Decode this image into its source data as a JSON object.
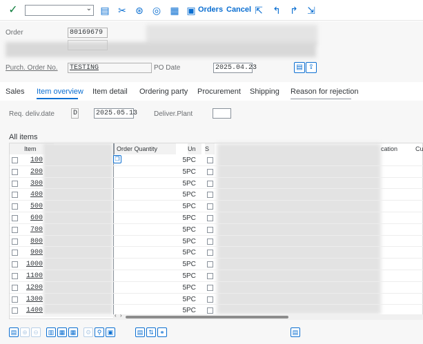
{
  "toolbar": {
    "command_value": "",
    "orders_label": "Orders",
    "cancel_label": "Cancel"
  },
  "header": {
    "order_label": "Order",
    "order_value": "80169679",
    "po_label": "Purch. Order No.",
    "po_value": "TESTING",
    "podate_label": "PO Date",
    "podate_value": "2025.04.23"
  },
  "tabs": [
    {
      "label": "Sales"
    },
    {
      "label": "Item overview"
    },
    {
      "label": "Item detail"
    },
    {
      "label": "Ordering party"
    },
    {
      "label": "Procurement"
    },
    {
      "label": "Shipping"
    },
    {
      "label": "Reason for rejection"
    }
  ],
  "subarea": {
    "reqdeliv_label": "Req. deliv.date",
    "reqdeliv_type": "D",
    "reqdeliv_value": "2025.05.13",
    "plant_label": "Deliver.Plant",
    "plant_value": ""
  },
  "table": {
    "title": "All items",
    "col_item": "Item",
    "col_qty": "Order Quantity",
    "col_un": "Un",
    "col_s": "S",
    "col_loc": "cation",
    "col_cu": "Cu",
    "rows": [
      {
        "item": "100",
        "qty": "5",
        "un": "PC"
      },
      {
        "item": "200",
        "qty": "5",
        "un": "PC"
      },
      {
        "item": "300",
        "qty": "5",
        "un": "PC"
      },
      {
        "item": "400",
        "qty": "5",
        "un": "PC"
      },
      {
        "item": "500",
        "qty": "5",
        "un": "PC"
      },
      {
        "item": "600",
        "qty": "5",
        "un": "PC"
      },
      {
        "item": "700",
        "qty": "5",
        "un": "PC"
      },
      {
        "item": "800",
        "qty": "5",
        "un": "PC"
      },
      {
        "item": "900",
        "qty": "5",
        "un": "PC"
      },
      {
        "item": "1000",
        "qty": "5",
        "un": "PC"
      },
      {
        "item": "1100",
        "qty": "5",
        "un": "PC"
      },
      {
        "item": "1200",
        "qty": "5",
        "un": "PC"
      },
      {
        "item": "1300",
        "qty": "5",
        "un": "PC"
      },
      {
        "item": "1400",
        "qty": "5",
        "un": "PC"
      }
    ]
  },
  "colors": {
    "accent": "#0a6ed1",
    "background": "#f7f7f7"
  }
}
